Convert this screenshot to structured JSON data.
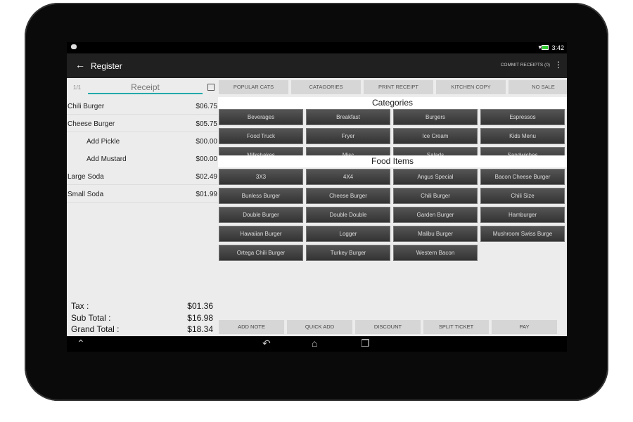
{
  "status": {
    "time": "3:42"
  },
  "appbar": {
    "title": "Register",
    "commit": "COMMIT RECEIPTS (0)"
  },
  "receipt": {
    "page": "1/1",
    "title": "Receipt",
    "lines": [
      {
        "name": "Chili Burger",
        "price": "$06.75",
        "modifier": false
      },
      {
        "name": "Cheese Burger",
        "price": "$05.75",
        "modifier": false
      },
      {
        "name": "Add Pickle",
        "price": "$00.00",
        "modifier": true
      },
      {
        "name": "Add Mustard",
        "price": "$00.00",
        "modifier": true
      },
      {
        "name": "Large Soda",
        "price": "$02.49",
        "modifier": false
      },
      {
        "name": "Small Soda",
        "price": "$01.99",
        "modifier": false
      }
    ],
    "tax_label": "Tax :",
    "tax": "$01.36",
    "subtotal_label": "Sub Total :",
    "subtotal": "$16.98",
    "grand_label": "Grand Total :",
    "grand": "$18.34"
  },
  "top_buttons": [
    "POPULAR CATS",
    "CATAGORIES",
    "PRINT RECEIPT",
    "KITCHEN COPY",
    "NO SALE"
  ],
  "categories_title": "Categories",
  "categories": [
    "Beverages",
    "Breakfast",
    "Burgers",
    "Espressos",
    "Food Truck",
    "Fryer",
    "Ice Cream",
    "Kids Menu",
    "Milkshakes",
    "Misc",
    "Salads",
    "Sandwiches"
  ],
  "food_title": "Food Items",
  "food_items": [
    "3X3",
    "4X4",
    "Angus Special",
    "Bacon Cheese Burger",
    "Bunless Burger",
    "Cheese Burger",
    "Chili Burger",
    "Chili Size",
    "Double Burger",
    "Double Double",
    "Garden Burger",
    "Hamburger",
    "Hawaiian Burger",
    "Logger",
    "Malibu Burger",
    "Mushroom Swiss Burge",
    "Ortega Chili Burger",
    "Turkey Burger",
    "Western Bacon"
  ],
  "bottom_buttons": [
    "ADD NOTE",
    "QUICK ADD",
    "DISCOUNT",
    "SPLIT TICKET",
    "PAY"
  ]
}
